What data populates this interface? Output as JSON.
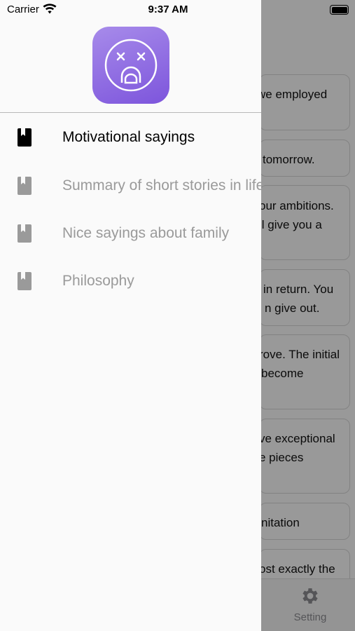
{
  "status_bar": {
    "carrier": "Carrier",
    "time": "9:37 AM"
  },
  "drawer": {
    "logo": "shocked-face-icon",
    "menu": [
      {
        "label": "Motivational sayings",
        "icon": "book-icon",
        "active": true
      },
      {
        "label": "Summary of short stories in life",
        "icon": "book-icon",
        "active": false
      },
      {
        "label": "Nice sayings about family",
        "icon": "book-icon",
        "active": false
      },
      {
        "label": "Philosophy",
        "icon": "book-icon",
        "active": false
      }
    ]
  },
  "background": {
    "cards": [
      {
        "lines": [
          "we employed"
        ]
      },
      {
        "lines": [
          "tomorrow."
        ]
      },
      {
        "lines": [
          "our ambitions.",
          "ll give you a"
        ]
      },
      {
        "lines": [
          "in return. You",
          "n give out."
        ]
      },
      {
        "lines": [
          "rove. The initial",
          "become"
        ]
      },
      {
        "lines": [
          "ve exceptional",
          "e pieces"
        ]
      },
      {
        "lines": [
          "nitation"
        ]
      },
      {
        "lines": [
          "ost exactly the"
        ]
      }
    ],
    "tabbar": {
      "setting_label": "Setting",
      "setting_icon": "gear-icon"
    }
  },
  "colors": {
    "accent_gradient_start": "#a78bea",
    "accent_gradient_end": "#7d55dc",
    "active_text": "#000000",
    "inactive_text": "#9a9a9a"
  }
}
